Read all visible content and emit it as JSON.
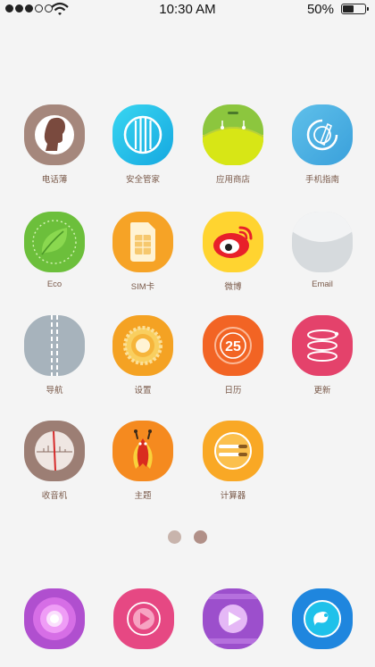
{
  "status_bar": {
    "time": "10:30 AM",
    "battery_percent": "50%",
    "battery_level": 0.5,
    "signal_bars_filled": 3,
    "signal_bars_total": 5
  },
  "apps": [
    {
      "label": "电话薄",
      "icon": "contacts-icon"
    },
    {
      "label": "安全管家",
      "icon": "security-icon"
    },
    {
      "label": "应用商店",
      "icon": "app-store-icon"
    },
    {
      "label": "手机指南",
      "icon": "phone-guide-icon"
    },
    {
      "label": "Eco",
      "icon": "eco-leaf-icon"
    },
    {
      "label": "SIM卡",
      "icon": "sim-card-icon"
    },
    {
      "label": "微博",
      "icon": "weibo-icon"
    },
    {
      "label": "Email",
      "icon": "email-icon"
    },
    {
      "label": "导航",
      "icon": "navigation-icon"
    },
    {
      "label": "设置",
      "icon": "settings-icon"
    },
    {
      "label": "日历",
      "icon": "calendar-icon",
      "badge": "25"
    },
    {
      "label": "更新",
      "icon": "update-icon"
    },
    {
      "label": "收音机",
      "icon": "radio-icon"
    },
    {
      "label": "主题",
      "icon": "theme-icon"
    },
    {
      "label": "计算器",
      "icon": "calculator-icon"
    }
  ],
  "page_indicator": {
    "pages": 2,
    "current": 2
  },
  "dock": [
    {
      "icon": "camera-icon"
    },
    {
      "icon": "music-player-icon"
    },
    {
      "icon": "video-player-icon"
    },
    {
      "icon": "browser-icon"
    }
  ],
  "colors": {
    "background": "#f4f4f4",
    "label": "#7a5a4a"
  }
}
